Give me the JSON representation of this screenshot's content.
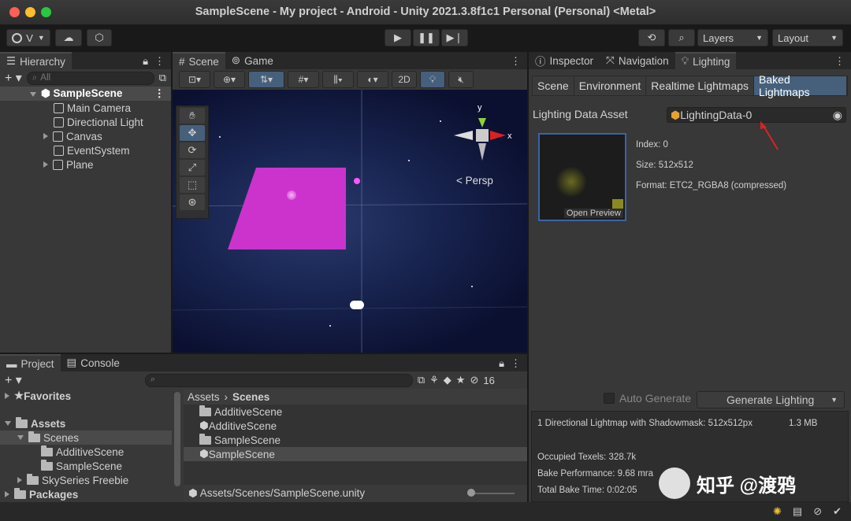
{
  "window": {
    "title": "SampleScene - My project - Android - Unity 2021.3.8f1c1 Personal (Personal) <Metal>"
  },
  "toolbar": {
    "account": "V",
    "layers": "Layers",
    "layout": "Layout"
  },
  "hierarchy": {
    "tab": "Hierarchy",
    "search_placeholder": "All",
    "scene": "SampleScene",
    "items": [
      "Main Camera",
      "Directional Light",
      "Canvas",
      "EventSystem",
      "Plane"
    ]
  },
  "scene_view": {
    "tabs": [
      "Scene",
      "Game"
    ],
    "btn_2d": "2D",
    "persp": "Persp",
    "axis_x": "x",
    "axis_y": "y"
  },
  "lighting": {
    "tabs": [
      "Inspector",
      "Navigation",
      "Lighting"
    ],
    "subtabs": [
      "Scene",
      "Environment",
      "Realtime Lightmaps",
      "Baked Lightmaps"
    ],
    "asset_label": "Lighting Data Asset",
    "asset_value": "LightingData-0",
    "index": "Index: 0",
    "size": "Size: 512x512",
    "format": "Format: ETC2_RGBA8 (compressed)",
    "open_preview": "Open Preview",
    "auto_generate": "Auto Generate",
    "generate": "Generate Lighting",
    "summary": "1 Directional Lightmap with Shadowmask: 512x512px",
    "summary_size": "1.3 MB",
    "occupied": "Occupied Texels: 328.7k",
    "perf": "Bake Performance: 9.68 mra",
    "bake_time": "Total Bake Time: 0:02:05"
  },
  "project": {
    "tabs": [
      "Project",
      "Console"
    ],
    "count": "16",
    "favorites": "Favorites",
    "assets": "Assets",
    "scenes": "Scenes",
    "tree": [
      "AdditiveScene",
      "SampleScene"
    ],
    "skyseries": "SkySeries Freebie",
    "packages": "Packages",
    "breadcrumb": [
      "Assets",
      "Scenes"
    ],
    "files": [
      "AdditiveScene",
      "AdditiveScene",
      "SampleScene",
      "SampleScene"
    ],
    "path": "Assets/Scenes/SampleScene.unity"
  },
  "watermark": "知乎 @渡鸦",
  "colors": {
    "accent": "#46607c",
    "plane": "#cc33cc"
  }
}
